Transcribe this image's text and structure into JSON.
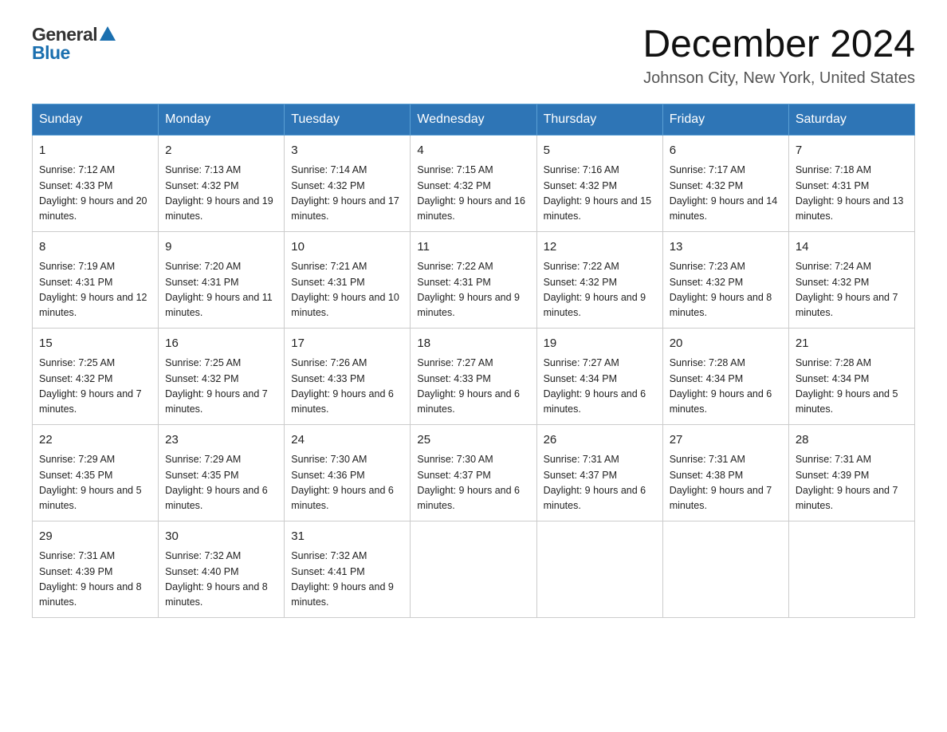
{
  "header": {
    "logo_general": "General",
    "logo_blue": "Blue",
    "month_title": "December 2024",
    "location": "Johnson City, New York, United States"
  },
  "days_of_week": [
    "Sunday",
    "Monday",
    "Tuesday",
    "Wednesday",
    "Thursday",
    "Friday",
    "Saturday"
  ],
  "weeks": [
    [
      {
        "day": "1",
        "sunrise": "7:12 AM",
        "sunset": "4:33 PM",
        "daylight": "9 hours and 20 minutes."
      },
      {
        "day": "2",
        "sunrise": "7:13 AM",
        "sunset": "4:32 PM",
        "daylight": "9 hours and 19 minutes."
      },
      {
        "day": "3",
        "sunrise": "7:14 AM",
        "sunset": "4:32 PM",
        "daylight": "9 hours and 17 minutes."
      },
      {
        "day": "4",
        "sunrise": "7:15 AM",
        "sunset": "4:32 PM",
        "daylight": "9 hours and 16 minutes."
      },
      {
        "day": "5",
        "sunrise": "7:16 AM",
        "sunset": "4:32 PM",
        "daylight": "9 hours and 15 minutes."
      },
      {
        "day": "6",
        "sunrise": "7:17 AM",
        "sunset": "4:32 PM",
        "daylight": "9 hours and 14 minutes."
      },
      {
        "day": "7",
        "sunrise": "7:18 AM",
        "sunset": "4:31 PM",
        "daylight": "9 hours and 13 minutes."
      }
    ],
    [
      {
        "day": "8",
        "sunrise": "7:19 AM",
        "sunset": "4:31 PM",
        "daylight": "9 hours and 12 minutes."
      },
      {
        "day": "9",
        "sunrise": "7:20 AM",
        "sunset": "4:31 PM",
        "daylight": "9 hours and 11 minutes."
      },
      {
        "day": "10",
        "sunrise": "7:21 AM",
        "sunset": "4:31 PM",
        "daylight": "9 hours and 10 minutes."
      },
      {
        "day": "11",
        "sunrise": "7:22 AM",
        "sunset": "4:31 PM",
        "daylight": "9 hours and 9 minutes."
      },
      {
        "day": "12",
        "sunrise": "7:22 AM",
        "sunset": "4:32 PM",
        "daylight": "9 hours and 9 minutes."
      },
      {
        "day": "13",
        "sunrise": "7:23 AM",
        "sunset": "4:32 PM",
        "daylight": "9 hours and 8 minutes."
      },
      {
        "day": "14",
        "sunrise": "7:24 AM",
        "sunset": "4:32 PM",
        "daylight": "9 hours and 7 minutes."
      }
    ],
    [
      {
        "day": "15",
        "sunrise": "7:25 AM",
        "sunset": "4:32 PM",
        "daylight": "9 hours and 7 minutes."
      },
      {
        "day": "16",
        "sunrise": "7:25 AM",
        "sunset": "4:32 PM",
        "daylight": "9 hours and 7 minutes."
      },
      {
        "day": "17",
        "sunrise": "7:26 AM",
        "sunset": "4:33 PM",
        "daylight": "9 hours and 6 minutes."
      },
      {
        "day": "18",
        "sunrise": "7:27 AM",
        "sunset": "4:33 PM",
        "daylight": "9 hours and 6 minutes."
      },
      {
        "day": "19",
        "sunrise": "7:27 AM",
        "sunset": "4:34 PM",
        "daylight": "9 hours and 6 minutes."
      },
      {
        "day": "20",
        "sunrise": "7:28 AM",
        "sunset": "4:34 PM",
        "daylight": "9 hours and 6 minutes."
      },
      {
        "day": "21",
        "sunrise": "7:28 AM",
        "sunset": "4:34 PM",
        "daylight": "9 hours and 5 minutes."
      }
    ],
    [
      {
        "day": "22",
        "sunrise": "7:29 AM",
        "sunset": "4:35 PM",
        "daylight": "9 hours and 5 minutes."
      },
      {
        "day": "23",
        "sunrise": "7:29 AM",
        "sunset": "4:35 PM",
        "daylight": "9 hours and 6 minutes."
      },
      {
        "day": "24",
        "sunrise": "7:30 AM",
        "sunset": "4:36 PM",
        "daylight": "9 hours and 6 minutes."
      },
      {
        "day": "25",
        "sunrise": "7:30 AM",
        "sunset": "4:37 PM",
        "daylight": "9 hours and 6 minutes."
      },
      {
        "day": "26",
        "sunrise": "7:31 AM",
        "sunset": "4:37 PM",
        "daylight": "9 hours and 6 minutes."
      },
      {
        "day": "27",
        "sunrise": "7:31 AM",
        "sunset": "4:38 PM",
        "daylight": "9 hours and 7 minutes."
      },
      {
        "day": "28",
        "sunrise": "7:31 AM",
        "sunset": "4:39 PM",
        "daylight": "9 hours and 7 minutes."
      }
    ],
    [
      {
        "day": "29",
        "sunrise": "7:31 AM",
        "sunset": "4:39 PM",
        "daylight": "9 hours and 8 minutes."
      },
      {
        "day": "30",
        "sunrise": "7:32 AM",
        "sunset": "4:40 PM",
        "daylight": "9 hours and 8 minutes."
      },
      {
        "day": "31",
        "sunrise": "7:32 AM",
        "sunset": "4:41 PM",
        "daylight": "9 hours and 9 minutes."
      },
      null,
      null,
      null,
      null
    ]
  ],
  "labels": {
    "sunrise_prefix": "Sunrise: ",
    "sunset_prefix": "Sunset: ",
    "daylight_prefix": "Daylight: "
  }
}
